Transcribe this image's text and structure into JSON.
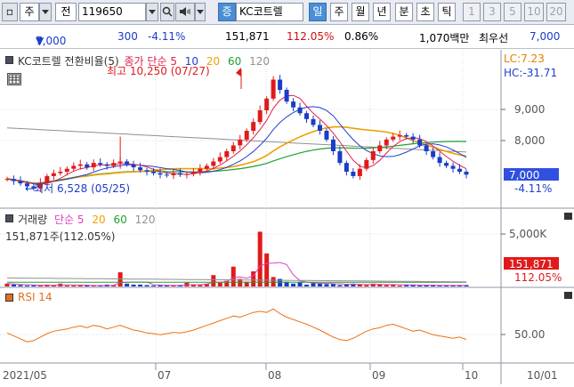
{
  "toolbar": {
    "left_icon": "square-icon",
    "market_label": "주",
    "market_icon": "chevron-down-icon",
    "jeon_label": "전",
    "stock_code": "119650",
    "mid_icons": [
      "chevron-down-icon",
      "search-icon",
      "speaker-icon",
      "chevron-down-icon"
    ],
    "exchange_badge": "증",
    "stock_name": "KC코트렐",
    "tabs": [
      "일",
      "주",
      "월",
      "년",
      "분",
      "초",
      "틱"
    ],
    "active_tab": "일",
    "number_buttons": [
      "1",
      "3",
      "5",
      "10",
      "20"
    ]
  },
  "quote": {
    "price": "7,000",
    "change": "300",
    "change_pct": "-4.11%",
    "volume": "151,871",
    "volume_ratio": "112.05%",
    "turnover": "0.86%",
    "amount": "1,070백만",
    "pref_label": "최우선",
    "pref_price": "7,000"
  },
  "price_panel": {
    "title": "KC코트렐 전환비율(5)",
    "ma_label": "종가 단순",
    "ma_periods": [
      "5",
      "10",
      "20",
      "60",
      "120"
    ],
    "ma_colors": [
      "#e0204a",
      "#2040d0",
      "#f0a000",
      "#20a030",
      "#909090"
    ],
    "high_annotation": "최고 10,250 (07/27)",
    "low_annotation": "←최저 6,528 (05/25)",
    "lc_label": "LC:7.23",
    "hc_label": "HC:-31.71",
    "y_ticks": [
      "9,000",
      "8,000"
    ],
    "current_price_tag": "7,000",
    "current_change_tag": "-4.11%"
  },
  "volume_panel": {
    "title": "거래량",
    "ma_label": "단순",
    "ma_periods": [
      "5",
      "20",
      "60",
      "120"
    ],
    "current": "151,871주(112.05%)",
    "y_tick": "5,000K",
    "current_tag": "151,871",
    "current_pct_tag": "112.05%"
  },
  "rsi_panel": {
    "title": "RSI 14",
    "y_tick": "50.00"
  },
  "x_axis": {
    "labels": [
      "2021/05",
      "07",
      "08",
      "09",
      "10"
    ],
    "right_label": "10/01"
  },
  "chart_data": {
    "type": "line",
    "price_series": [
      6.85,
      6.78,
      6.7,
      6.6,
      6.53,
      6.72,
      6.95,
      7.05,
      7.1,
      7.2,
      7.3,
      7.35,
      7.25,
      7.4,
      7.35,
      7.3,
      7.4,
      7.45,
      7.35,
      7.25,
      7.15,
      7.1,
      7.05,
      7.0,
      6.98,
      7.05,
      7.0,
      7.02,
      7.1,
      7.2,
      7.3,
      7.45,
      7.6,
      7.8,
      8.0,
      8.2,
      8.5,
      8.8,
      9.2,
      9.6,
      10.25,
      9.9,
      9.5,
      9.3,
      9.1,
      8.9,
      8.7,
      8.5,
      8.2,
      7.8,
      7.4,
      7.1,
      6.95,
      7.2,
      7.5,
      7.8,
      8.0,
      8.2,
      8.3,
      8.35,
      8.3,
      8.2,
      8.0,
      7.8,
      7.6,
      7.4,
      7.3,
      7.2,
      7.1,
      7.0
    ],
    "volume_series": [
      0.3,
      0.2,
      0.15,
      0.1,
      0.12,
      0.1,
      0.2,
      0.15,
      0.3,
      0.1,
      0.1,
      0.12,
      0.1,
      0.1,
      0.1,
      0.2,
      0.15,
      1.5,
      0.3,
      0.2,
      0.2,
      0.15,
      0.1,
      0.12,
      0.1,
      0.1,
      0.15,
      0.4,
      0.2,
      0.15,
      0.3,
      1.2,
      0.4,
      0.6,
      2.1,
      0.8,
      0.5,
      1.6,
      5.8,
      3.5,
      1.0,
      0.8,
      0.5,
      0.3,
      0.5,
      0.2,
      0.4,
      0.3,
      0.25,
      0.3,
      0.15,
      0.2,
      0.3,
      0.2,
      0.15,
      0.3,
      0.2,
      0.15,
      0.2,
      0.1,
      0.2,
      0.15,
      0.1,
      0.15,
      0.12,
      0.1,
      0.15,
      0.1,
      0.12,
      0.15
    ],
    "rsi_series": [
      45,
      40,
      35,
      30,
      32,
      38,
      44,
      48,
      50,
      52,
      55,
      57,
      54,
      58,
      56,
      52,
      55,
      58,
      54,
      50,
      48,
      45,
      44,
      42,
      44,
      46,
      45,
      47,
      50,
      54,
      58,
      62,
      66,
      70,
      74,
      72,
      76,
      80,
      82,
      80,
      86,
      78,
      72,
      68,
      64,
      60,
      55,
      50,
      44,
      38,
      34,
      32,
      36,
      42,
      48,
      52,
      54,
      58,
      60,
      56,
      52,
      48,
      50,
      46,
      42,
      40,
      38,
      36,
      38,
      34
    ],
    "ylim": [
      6.4,
      10.6
    ]
  }
}
